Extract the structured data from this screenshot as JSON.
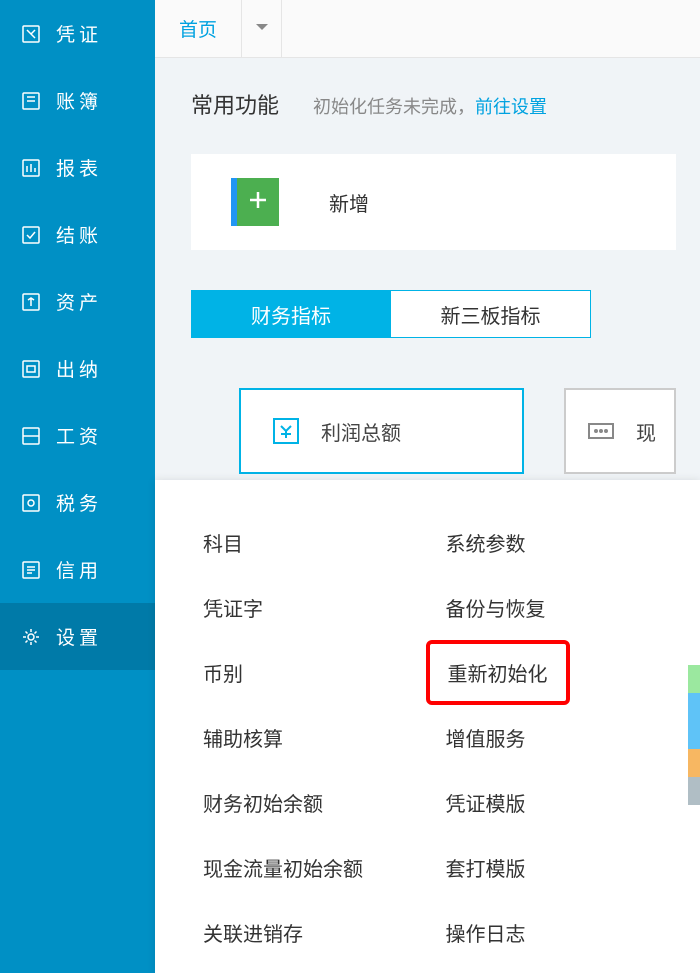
{
  "sidebar": {
    "items": [
      {
        "label": "凭证"
      },
      {
        "label": "账簿"
      },
      {
        "label": "报表"
      },
      {
        "label": "结账"
      },
      {
        "label": "资产"
      },
      {
        "label": "出纳"
      },
      {
        "label": "工资"
      },
      {
        "label": "税务"
      },
      {
        "label": "信用"
      },
      {
        "label": "设置"
      }
    ]
  },
  "tabbar": {
    "home": "首页"
  },
  "section": {
    "title": "常用功能",
    "init_warning": "初始化任务未完成，",
    "init_link": "前往设置"
  },
  "add": {
    "label": "新增"
  },
  "toggle": {
    "finance": "财务指标",
    "neeq": "新三板指标"
  },
  "card": {
    "profit": "利润总额",
    "secondary": "现"
  },
  "submenu": {
    "left": [
      "科目",
      "凭证字",
      "币别",
      "辅助核算",
      "财务初始余额",
      "现金流量初始余额",
      "关联进销存"
    ],
    "right": [
      "系统参数",
      "备份与恢复",
      "重新初始化",
      "增值服务",
      "凭证模版",
      "套打模版",
      "操作日志"
    ]
  }
}
